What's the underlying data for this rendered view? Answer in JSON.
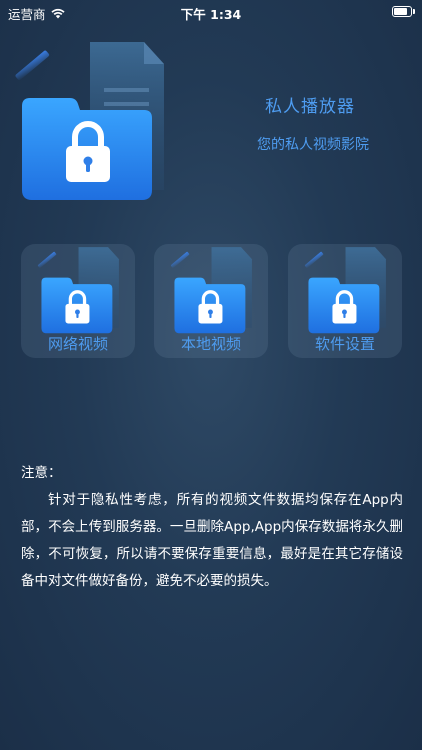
{
  "status_bar": {
    "carrier": "运营商",
    "time": "下午 1:34",
    "battery_level": 0.9
  },
  "hero": {
    "title": "私人播放器",
    "subtitle": "您的私人视频影院"
  },
  "tiles": [
    {
      "label": "网络视频"
    },
    {
      "label": "本地视频"
    },
    {
      "label": "软件设置"
    }
  ],
  "notice": {
    "title": "注意：",
    "body": "针对于隐私性考虑，所有的视频文件数据均保存在App内部，不会上传到服务器。一旦删除App,App内保存数据将永久删除，不可恢复，所以请不要保存重要信息，最好是在其它存储设备中对文件做好备份，避免不必要的损失。"
  },
  "colors": {
    "accent": "#4e9cf0",
    "folder": "#2f8df0"
  },
  "icons": {
    "hero": "locked-folder-icon",
    "tile": "locked-folder-icon",
    "wifi": "wifi-icon",
    "battery": "battery-icon"
  }
}
